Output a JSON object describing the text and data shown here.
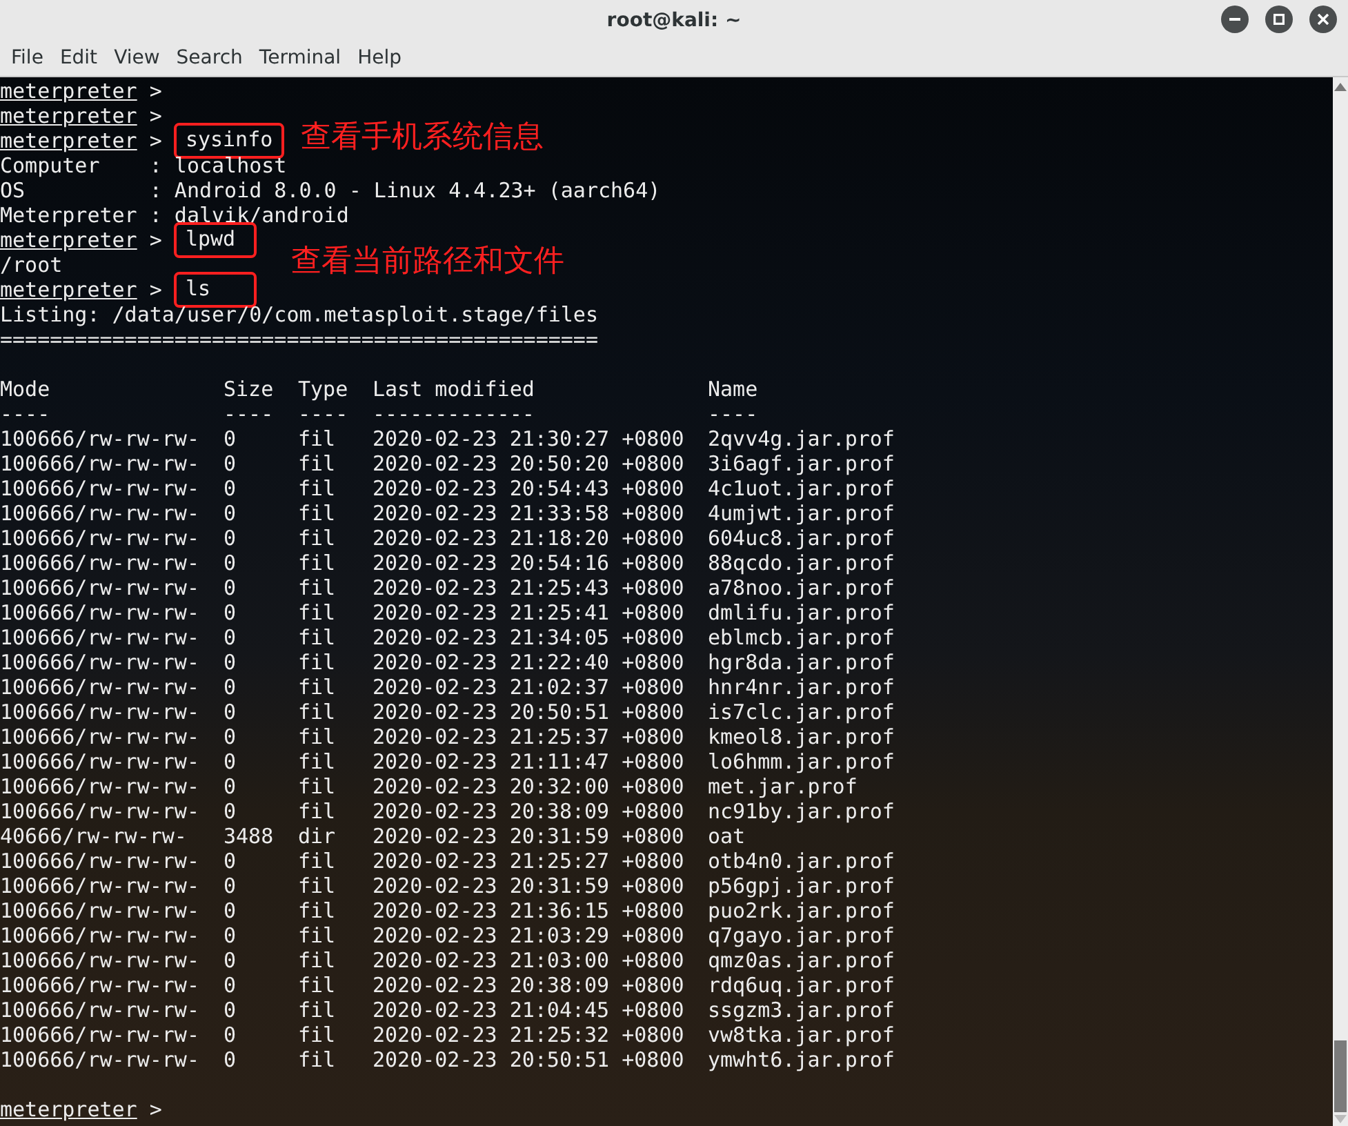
{
  "window": {
    "title": "root@kali: ~",
    "controls": [
      {
        "kind": "minimize"
      },
      {
        "kind": "maximize"
      },
      {
        "kind": "close"
      }
    ]
  },
  "menu": [
    "File",
    "Edit",
    "View",
    "Search",
    "Terminal",
    "Help"
  ],
  "lines": [
    {
      "kind": "prompt",
      "prompt": "meterpreter",
      "sign": ">"
    },
    {
      "kind": "prompt",
      "prompt": "meterpreter",
      "sign": ">"
    },
    {
      "kind": "prompt",
      "prompt": "meterpreter",
      "sign": ">",
      "command": "sysinfo",
      "highlighted": true,
      "annotation": "查看手机系统信息"
    },
    {
      "kind": "output",
      "text": "Computer    : localhost"
    },
    {
      "kind": "output",
      "text": "OS          : Android 8.0.0 - Linux 4.4.23+ (aarch64)"
    },
    {
      "kind": "output",
      "text": "Meterpreter : dalvik/android"
    },
    {
      "kind": "prompt",
      "prompt": "meterpreter",
      "sign": ">",
      "command": "lpwd",
      "highlighted": true
    },
    {
      "kind": "output",
      "text": "/root",
      "annotation": "查看当前路径和文件"
    },
    {
      "kind": "prompt",
      "prompt": "meterpreter",
      "sign": ">",
      "command": "ls",
      "highlighted": true
    },
    {
      "kind": "output",
      "text": "Listing: /data/user/0/com.metasploit.stage/files"
    },
    {
      "kind": "output",
      "text": "================================================"
    },
    {
      "kind": "blank"
    },
    {
      "kind": "table",
      "columns": [
        "Mode",
        "Size",
        "Type",
        "Last modified",
        "Name"
      ],
      "underline": [
        "----",
        "----",
        "----",
        "-------------",
        "----"
      ],
      "rows": [
        [
          "100666/rw-rw-rw-",
          "0",
          "fil",
          "2020-02-23 21:30:27 +0800",
          "2qvv4g.jar.prof"
        ],
        [
          "100666/rw-rw-rw-",
          "0",
          "fil",
          "2020-02-23 20:50:20 +0800",
          "3i6agf.jar.prof"
        ],
        [
          "100666/rw-rw-rw-",
          "0",
          "fil",
          "2020-02-23 20:54:43 +0800",
          "4c1uot.jar.prof"
        ],
        [
          "100666/rw-rw-rw-",
          "0",
          "fil",
          "2020-02-23 21:33:58 +0800",
          "4umjwt.jar.prof"
        ],
        [
          "100666/rw-rw-rw-",
          "0",
          "fil",
          "2020-02-23 21:18:20 +0800",
          "604uc8.jar.prof"
        ],
        [
          "100666/rw-rw-rw-",
          "0",
          "fil",
          "2020-02-23 20:54:16 +0800",
          "88qcdo.jar.prof"
        ],
        [
          "100666/rw-rw-rw-",
          "0",
          "fil",
          "2020-02-23 21:25:43 +0800",
          "a78noo.jar.prof"
        ],
        [
          "100666/rw-rw-rw-",
          "0",
          "fil",
          "2020-02-23 21:25:41 +0800",
          "dmlifu.jar.prof"
        ],
        [
          "100666/rw-rw-rw-",
          "0",
          "fil",
          "2020-02-23 21:34:05 +0800",
          "eblmcb.jar.prof"
        ],
        [
          "100666/rw-rw-rw-",
          "0",
          "fil",
          "2020-02-23 21:22:40 +0800",
          "hgr8da.jar.prof"
        ],
        [
          "100666/rw-rw-rw-",
          "0",
          "fil",
          "2020-02-23 21:02:37 +0800",
          "hnr4nr.jar.prof"
        ],
        [
          "100666/rw-rw-rw-",
          "0",
          "fil",
          "2020-02-23 20:50:51 +0800",
          "is7clc.jar.prof"
        ],
        [
          "100666/rw-rw-rw-",
          "0",
          "fil",
          "2020-02-23 21:25:37 +0800",
          "kmeol8.jar.prof"
        ],
        [
          "100666/rw-rw-rw-",
          "0",
          "fil",
          "2020-02-23 21:11:47 +0800",
          "lo6hmm.jar.prof"
        ],
        [
          "100666/rw-rw-rw-",
          "0",
          "fil",
          "2020-02-23 20:32:00 +0800",
          "met.jar.prof"
        ],
        [
          "100666/rw-rw-rw-",
          "0",
          "fil",
          "2020-02-23 20:38:09 +0800",
          "nc91by.jar.prof"
        ],
        [
          "40666/rw-rw-rw-",
          "3488",
          "dir",
          "2020-02-23 20:31:59 +0800",
          "oat"
        ],
        [
          "100666/rw-rw-rw-",
          "0",
          "fil",
          "2020-02-23 21:25:27 +0800",
          "otb4n0.jar.prof"
        ],
        [
          "100666/rw-rw-rw-",
          "0",
          "fil",
          "2020-02-23 20:31:59 +0800",
          "p56gpj.jar.prof"
        ],
        [
          "100666/rw-rw-rw-",
          "0",
          "fil",
          "2020-02-23 21:36:15 +0800",
          "puo2rk.jar.prof"
        ],
        [
          "100666/rw-rw-rw-",
          "0",
          "fil",
          "2020-02-23 21:03:29 +0800",
          "q7gayo.jar.prof"
        ],
        [
          "100666/rw-rw-rw-",
          "0",
          "fil",
          "2020-02-23 21:03:00 +0800",
          "qmz0as.jar.prof"
        ],
        [
          "100666/rw-rw-rw-",
          "0",
          "fil",
          "2020-02-23 20:38:09 +0800",
          "rdq6uq.jar.prof"
        ],
        [
          "100666/rw-rw-rw-",
          "0",
          "fil",
          "2020-02-23 21:04:45 +0800",
          "ssgzm3.jar.prof"
        ],
        [
          "100666/rw-rw-rw-",
          "0",
          "fil",
          "2020-02-23 21:25:32 +0800",
          "vw8tka.jar.prof"
        ],
        [
          "100666/rw-rw-rw-",
          "0",
          "fil",
          "2020-02-23 20:50:51 +0800",
          "ymwht6.jar.prof"
        ]
      ]
    },
    {
      "kind": "blank"
    },
    {
      "kind": "prompt",
      "prompt": "meterpreter",
      "sign": ">"
    }
  ]
}
